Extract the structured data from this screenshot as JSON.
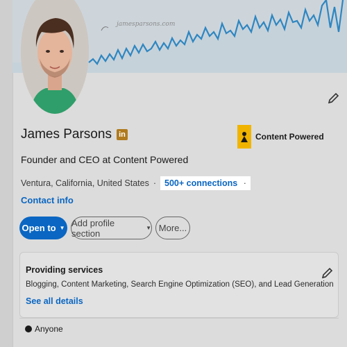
{
  "profile": {
    "name": "James Parsons",
    "linkedin_badge": "in",
    "headline": "Founder and CEO at Content Powered",
    "location": "Ventura, California, United States",
    "separator": "·",
    "connections": "500+ connections",
    "contact_info": "Contact info"
  },
  "banner": {
    "watermark": "jamesparsons.com"
  },
  "company": {
    "name": "Content Powered"
  },
  "actions": {
    "open_to": "Open to",
    "add_profile_section": "Add profile section",
    "more": "More..."
  },
  "services": {
    "title": "Providing services",
    "list": "Blogging, Content Marketing, Search Engine Optimization (SEO), and Lead Generation",
    "see_all": "See all details"
  },
  "visibility": {
    "label": "Anyone"
  },
  "colors": {
    "accent": "#0a66c2",
    "chart_line": "#2e86c1",
    "badge": "#b07a1e",
    "company_logo": "#f0b400"
  }
}
